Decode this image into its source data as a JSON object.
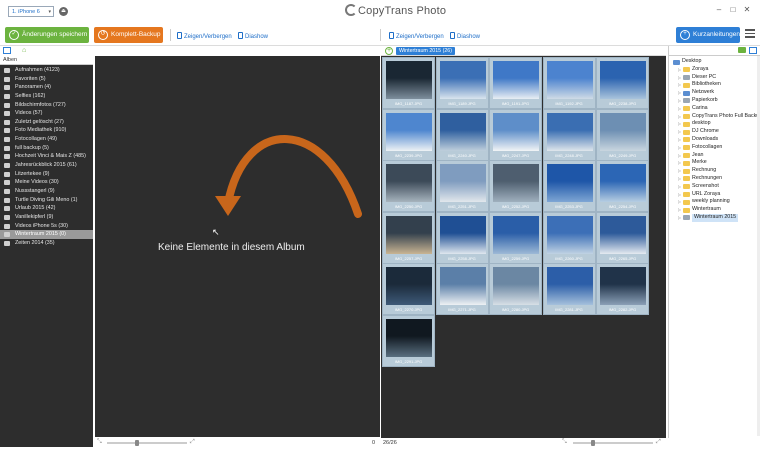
{
  "titlebar": {
    "device": "1. iPhone 6",
    "app_title": "CopyTrans Photo"
  },
  "toolbar": {
    "save_label": "Änderungen speichern",
    "backup_label": "Komplett-Backup",
    "show_hide_left": "Zeigen/Verbergen",
    "slideshow_left": "Diashow",
    "show_hide_right": "Zeigen/Verbergen",
    "slideshow_right": "Diashow",
    "help_label": "Kurzanleitungen"
  },
  "albums": {
    "header": "Alben",
    "items": [
      "Aufnahmen (4123)",
      "Favoriten (5)",
      "Panoramen (4)",
      "Selfies (162)",
      "Bildschirmfotos (727)",
      "Videos (57)",
      "Zuletzt gelöscht (27)",
      "Foto Mediathek (910)",
      "Fotocollagen (49)",
      "full backup (5)",
      "Hochzeit Vinci & Mais Z (485)",
      "Jahresrückblick 2015 (61)",
      "Litzertekee (9)",
      "Meine Videos (30)",
      "Nussstangerl (9)",
      "Turtle Diving Gili Meno (1)",
      "Urlaub 2015 (42)",
      "Vanillekipferl (9)",
      "Videos iPhone 5s (30)",
      "Wintertraum 2015 (0)",
      "Zeiten 2014 (35)"
    ],
    "selected_index": 19
  },
  "center": {
    "empty_message": "Keine Elemente in diesem Album",
    "count": "0"
  },
  "photos": {
    "album_tag": "Wintertraum 2015 (26)",
    "count": "26/26",
    "captions": [
      "IMG_1187.JPG",
      "IMG_1189.JPG",
      "IMG_1191.JPG",
      "IMG_1192.JPG",
      "IMG_2238.JPG",
      "IMG_2239.JPG",
      "IMG_2240.JPG",
      "IMG_2247.JPG",
      "IMG_2248.JPG",
      "IMG_2249.JPG",
      "IMG_2250.JPG",
      "IMG_2251.JPG",
      "IMG_2252.JPG",
      "IMG_2253.JPG",
      "IMG_2254.JPG",
      "IMG_2257.JPG",
      "IMG_2258.JPG",
      "IMG_2259.JPG",
      "IMG_2260.JPG",
      "IMG_2265.JPG",
      "IMG_2270.JPG",
      "IMG_2271.JPG",
      "IMG_2280.JPG",
      "IMG_2281.JPG",
      "IMG_2282.JPG",
      "IMG_2291.JPG"
    ]
  },
  "folders": {
    "items": [
      {
        "label": "Desktop",
        "level": 0,
        "icon": "blue"
      },
      {
        "label": "Zoraya",
        "level": 1,
        "icon": "yellow"
      },
      {
        "label": "Dieser PC",
        "level": 1,
        "icon": "gray"
      },
      {
        "label": "Bibliotheken",
        "level": 1,
        "icon": "yellow"
      },
      {
        "label": "Netzwerk",
        "level": 1,
        "icon": "blue"
      },
      {
        "label": "Papierkorb",
        "level": 1,
        "icon": "gray"
      },
      {
        "label": "Carina",
        "level": 1,
        "icon": "yellow"
      },
      {
        "label": "CopyTrans Photo Full Backup",
        "level": 1,
        "icon": "yellow"
      },
      {
        "label": "desktop",
        "level": 1,
        "icon": "yellow"
      },
      {
        "label": "DJ Chrome",
        "level": 1,
        "icon": "yellow"
      },
      {
        "label": "Downloads",
        "level": 1,
        "icon": "yellow"
      },
      {
        "label": "Fotocollagen",
        "level": 1,
        "icon": "yellow"
      },
      {
        "label": "Jean",
        "level": 1,
        "icon": "yellow"
      },
      {
        "label": "Merke",
        "level": 1,
        "icon": "yellow"
      },
      {
        "label": "Rechnung",
        "level": 1,
        "icon": "yellow"
      },
      {
        "label": "Rechnungen",
        "level": 1,
        "icon": "yellow"
      },
      {
        "label": "Screenshot",
        "level": 1,
        "icon": "yellow"
      },
      {
        "label": "URL Zoraya",
        "level": 1,
        "icon": "yellow"
      },
      {
        "label": "weekly planning",
        "level": 1,
        "icon": "yellow"
      },
      {
        "label": "Wintertraum",
        "level": 1,
        "icon": "yellow"
      },
      {
        "label": "Wintertraum 2015",
        "level": 1,
        "icon": "gray"
      }
    ],
    "selected_index": 20
  },
  "colors": {
    "save_green": "#6cb33f",
    "backup_orange": "#e5771f",
    "help_blue": "#2e7fd6",
    "arrow_orange": "#c8661b"
  }
}
